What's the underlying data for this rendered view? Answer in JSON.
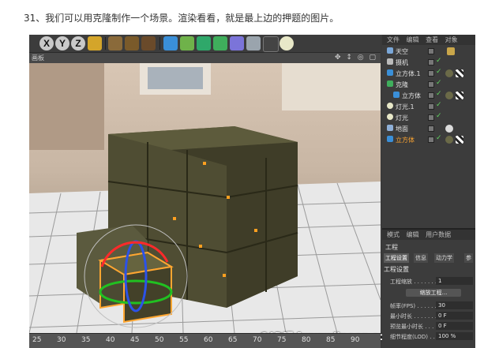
{
  "caption": "31、我们可以用克隆制作一个场景。渲染看看，就是最上边的押题的图片。",
  "toolbar": {
    "axis_x": "X",
    "axis_y": "Y",
    "axis_z": "Z"
  },
  "viewport": {
    "title": "画板",
    "icons": "✥ ↕ ◎ ▢"
  },
  "watermark": "C4D吧 [www.linecg.com/tieba/1799]",
  "ruler": {
    "ticks": [
      "25",
      "30",
      "35",
      "40",
      "45",
      "50",
      "55",
      "60",
      "65",
      "70",
      "75",
      "80",
      "85",
      "90"
    ]
  },
  "object_manager": {
    "menu": [
      "文件",
      "编辑",
      "查看",
      "对象"
    ],
    "rows": [
      {
        "name": "天空",
        "selected": false
      },
      {
        "name": "摄机",
        "selected": false
      },
      {
        "name": "立方体.1",
        "selected": false
      },
      {
        "name": "克隆",
        "selected": false
      },
      {
        "name": "立方体",
        "selected": false
      },
      {
        "name": "灯光.1",
        "selected": false
      },
      {
        "name": "灯光",
        "selected": false
      },
      {
        "name": "地面",
        "selected": false
      },
      {
        "name": "立方体",
        "selected": true
      }
    ]
  },
  "attribute_manager": {
    "menu": [
      "模式",
      "编辑",
      "用户数据"
    ],
    "title": "工程",
    "tabs": [
      "工程设置",
      "信息",
      "动力学",
      "参"
    ],
    "section": "工程设置",
    "fields": [
      {
        "label": "工程缩放 . . . . . . .",
        "value": "1"
      },
      {
        "label": "帧率(FPS) . . . . . .",
        "value": "30"
      },
      {
        "label": "最小时长 . . . . . . .",
        "value": "0 F"
      },
      {
        "label": "预览最小时长 . . .",
        "value": "0 F"
      },
      {
        "label": "细节程度(LOD) . .",
        "value": "100 %"
      }
    ],
    "scale_button": "缩放工程..."
  },
  "colors": {
    "selection": "#ffa631",
    "check": "#5fd35f",
    "panel": "#3c3c3c"
  }
}
